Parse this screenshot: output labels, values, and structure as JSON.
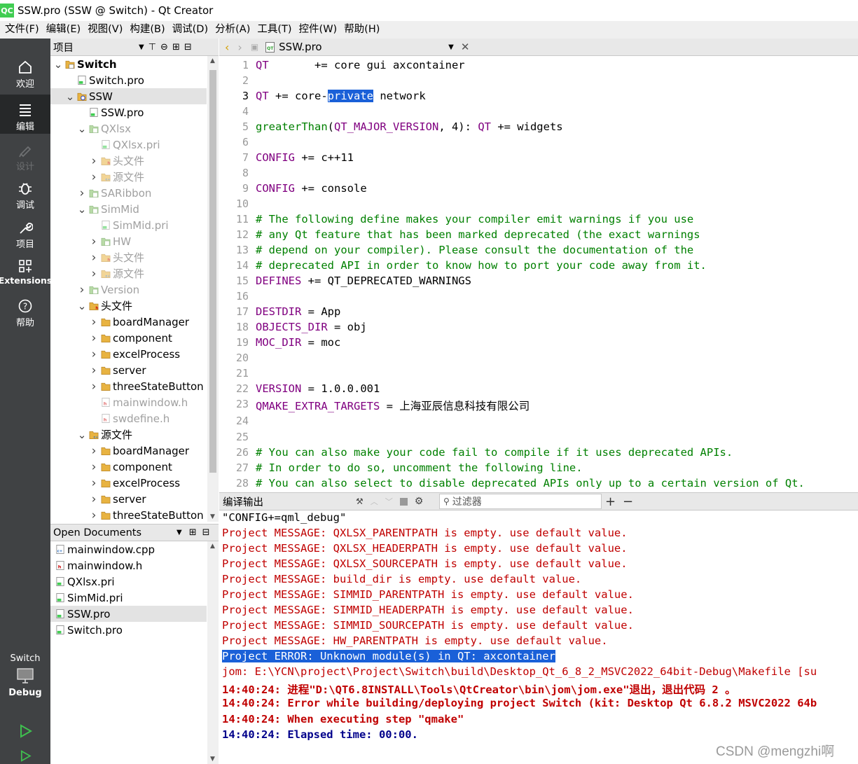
{
  "window": {
    "icon_text": "QC",
    "title": "SSW.pro (SSW @ Switch) - Qt Creator"
  },
  "menu": [
    "文件(F)",
    "编辑(E)",
    "视图(V)",
    "构建(B)",
    "调试(D)",
    "分析(A)",
    "工具(T)",
    "控件(W)",
    "帮助(H)"
  ],
  "modes": {
    "welcome": "欢迎",
    "edit": "编辑",
    "design": "设计",
    "debug": "调试",
    "projects": "项目",
    "extensions": "Extensions",
    "help": "帮助",
    "kit_project": "Switch",
    "kit_build": "Debug"
  },
  "project_panel": {
    "title": "项目"
  },
  "project_tree": [
    {
      "label": "Switch",
      "level": 0,
      "arrow": "v",
      "icon": "folder-proj",
      "bold": true
    },
    {
      "label": "Switch.pro",
      "level": 1,
      "arrow": "",
      "icon": "pro"
    },
    {
      "label": "SSW",
      "level": 1,
      "arrow": "v",
      "icon": "folder-gear",
      "selected": true
    },
    {
      "label": "SSW.pro",
      "level": 2,
      "arrow": "",
      "icon": "pro"
    },
    {
      "label": "QXlsx",
      "level": 2,
      "arrow": "v",
      "icon": "folder-green",
      "dim": true
    },
    {
      "label": "QXlsx.pri",
      "level": 3,
      "arrow": "",
      "icon": "pro",
      "dim": true
    },
    {
      "label": "头文件",
      "level": 3,
      "arrow": ">",
      "icon": "folder-h",
      "dim": true
    },
    {
      "label": "源文件",
      "level": 3,
      "arrow": ">",
      "icon": "folder-cpp",
      "dim": true
    },
    {
      "label": "SARibbon",
      "level": 2,
      "arrow": ">",
      "icon": "folder-green",
      "dim": true
    },
    {
      "label": "SimMid",
      "level": 2,
      "arrow": "v",
      "icon": "folder-green",
      "dim": true
    },
    {
      "label": "SimMid.pri",
      "level": 3,
      "arrow": "",
      "icon": "pro",
      "dim": true
    },
    {
      "label": "HW",
      "level": 3,
      "arrow": ">",
      "icon": "folder-green",
      "dim": true
    },
    {
      "label": "头文件",
      "level": 3,
      "arrow": ">",
      "icon": "folder-h",
      "dim": true
    },
    {
      "label": "源文件",
      "level": 3,
      "arrow": ">",
      "icon": "folder-cpp",
      "dim": true
    },
    {
      "label": "Version",
      "level": 2,
      "arrow": ">",
      "icon": "folder-green",
      "dim": true
    },
    {
      "label": "头文件",
      "level": 2,
      "arrow": "v",
      "icon": "folder-h"
    },
    {
      "label": "boardManager",
      "level": 3,
      "arrow": ">",
      "icon": "folder"
    },
    {
      "label": "component",
      "level": 3,
      "arrow": ">",
      "icon": "folder"
    },
    {
      "label": "excelProcess",
      "level": 3,
      "arrow": ">",
      "icon": "folder"
    },
    {
      "label": "server",
      "level": 3,
      "arrow": ">",
      "icon": "folder"
    },
    {
      "label": "threeStateButton",
      "level": 3,
      "arrow": ">",
      "icon": "folder"
    },
    {
      "label": "mainwindow.h",
      "level": 3,
      "arrow": "",
      "icon": "h",
      "dim": true
    },
    {
      "label": "swdefine.h",
      "level": 3,
      "arrow": "",
      "icon": "h",
      "dim": true
    },
    {
      "label": "源文件",
      "level": 2,
      "arrow": "v",
      "icon": "folder-cpp"
    },
    {
      "label": "boardManager",
      "level": 3,
      "arrow": ">",
      "icon": "folder"
    },
    {
      "label": "component",
      "level": 3,
      "arrow": ">",
      "icon": "folder"
    },
    {
      "label": "excelProcess",
      "level": 3,
      "arrow": ">",
      "icon": "folder"
    },
    {
      "label": "server",
      "level": 3,
      "arrow": ">",
      "icon": "folder"
    },
    {
      "label": "threeStateButton",
      "level": 3,
      "arrow": ">",
      "icon": "folder"
    }
  ],
  "open_docs": {
    "title": "Open Documents",
    "items": [
      {
        "label": "mainwindow.cpp",
        "icon": "cpp"
      },
      {
        "label": "mainwindow.h",
        "icon": "h"
      },
      {
        "label": "QXlsx.pri",
        "icon": "pro"
      },
      {
        "label": "SimMid.pri",
        "icon": "pro"
      },
      {
        "label": "SSW.pro",
        "icon": "pro",
        "selected": true
      },
      {
        "label": "Switch.pro",
        "icon": "pro"
      }
    ]
  },
  "editor": {
    "file": "SSW.pro",
    "current_line": 3,
    "lines": [
      [
        [
          "kw",
          "QT"
        ],
        [
          "",
          "       += core gui axcontainer"
        ]
      ],
      [],
      [
        [
          "kw",
          "QT"
        ],
        [
          "",
          " += core-"
        ],
        [
          "hl",
          "private"
        ],
        [
          "",
          " network"
        ]
      ],
      [],
      [
        [
          "fn",
          "greaterThan"
        ],
        [
          "",
          "("
        ],
        [
          "kw",
          "QT_MAJOR_VERSION"
        ],
        [
          "",
          ", 4): "
        ],
        [
          "kw",
          "QT"
        ],
        [
          "",
          " += widgets"
        ]
      ],
      [],
      [
        [
          "kw",
          "CONFIG"
        ],
        [
          "",
          " += c++11"
        ]
      ],
      [],
      [
        [
          "kw",
          "CONFIG"
        ],
        [
          "",
          " += console"
        ]
      ],
      [],
      [
        [
          "cm",
          "# The following define makes your compiler emit warnings if you use"
        ]
      ],
      [
        [
          "cm",
          "# any Qt feature that has been marked deprecated (the exact warnings"
        ]
      ],
      [
        [
          "cm",
          "# depend on your compiler). Please consult the documentation of the"
        ]
      ],
      [
        [
          "cm",
          "# deprecated API in order to know how to port your code away from it."
        ]
      ],
      [
        [
          "kw",
          "DEFINES"
        ],
        [
          "",
          " += QT_DEPRECATED_WARNINGS"
        ]
      ],
      [],
      [
        [
          "kw",
          "DESTDIR"
        ],
        [
          "",
          " = App"
        ]
      ],
      [
        [
          "kw",
          "OBJECTS_DIR"
        ],
        [
          "",
          " = obj"
        ]
      ],
      [
        [
          "kw",
          "MOC_DIR"
        ],
        [
          "",
          " = moc"
        ]
      ],
      [],
      [],
      [
        [
          "kw",
          "VERSION"
        ],
        [
          "",
          " = 1.0.0.001"
        ]
      ],
      [
        [
          "kw",
          "QMAKE_EXTRA_TARGETS"
        ],
        [
          "",
          " = 上海亚辰信息科技有限公司"
        ]
      ],
      [],
      [],
      [
        [
          "cm",
          "# You can also make your code fail to compile if it uses deprecated APIs."
        ]
      ],
      [
        [
          "cm",
          "# In order to do so, uncomment the following line."
        ]
      ],
      [
        [
          "cm",
          "# You can also select to disable deprecated APIs only up to a certain version of Qt."
        ]
      ]
    ]
  },
  "output_panel": {
    "title": "编译输出",
    "filter_placeholder": "过滤器",
    "lines": [
      {
        "style": "black",
        "text": "\"CONFIG+=qml_debug\""
      },
      {
        "style": "red",
        "text": "Project MESSAGE: QXLSX_PARENTPATH is empty. use default value."
      },
      {
        "style": "red",
        "text": "Project MESSAGE: QXLSX_HEADERPATH is empty. use default value."
      },
      {
        "style": "red",
        "text": "Project MESSAGE: QXLSX_SOURCEPATH is empty. use default value."
      },
      {
        "style": "red",
        "text": "Project MESSAGE: build_dir is empty. use default value."
      },
      {
        "style": "red",
        "text": "Project MESSAGE: SIMMID_PARENTPATH is empty. use default value."
      },
      {
        "style": "red",
        "text": "Project MESSAGE: SIMMID_HEADERPATH is empty. use default value."
      },
      {
        "style": "red",
        "text": "Project MESSAGE: SIMMID_SOURCEPATH is empty. use default value."
      },
      {
        "style": "red",
        "text": "Project MESSAGE: HW_PARENTPATH is empty. use default value."
      },
      {
        "style": "selline",
        "text": "Project ERROR: Unknown module(s) in QT: axcontainer"
      },
      {
        "style": "red",
        "text": "jom: E:\\YCN\\project\\Project\\Switch\\build\\Desktop_Qt_6_8_2_MSVC2022_64bit-Debug\\Makefile [su"
      },
      {
        "style": "bred",
        "text": "14:40:24: 进程\"D:\\QT6.8INSTALL\\Tools\\QtCreator\\bin\\jom\\jom.exe\"退出，退出代码 2 。"
      },
      {
        "style": "bred",
        "text": "14:40:24: Error while building/deploying project Switch (kit: Desktop Qt 6.8.2 MSVC2022 64b"
      },
      {
        "style": "bred",
        "text": "14:40:24: When executing step \"qmake\""
      },
      {
        "style": "bblue",
        "text": "14:40:24: Elapsed time: 00:00."
      }
    ]
  },
  "watermark": "CSDN @mengzhi啊"
}
